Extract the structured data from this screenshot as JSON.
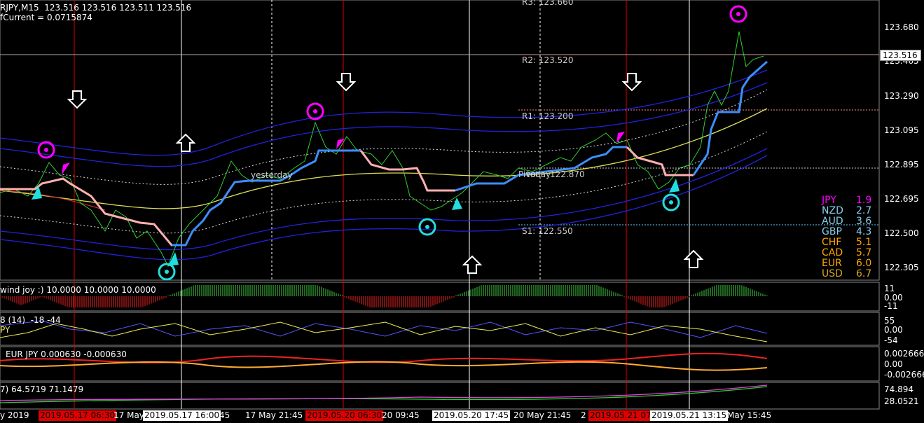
{
  "header": {
    "symbol_line": "RJPY,M15  123.516 123.516 123.511 123.516",
    "current_line": "fCurrent = 0.0715874"
  },
  "pivots": {
    "r3": "R3: 123.660",
    "r2": "R2: 123.520",
    "r1": "R1: 123.200",
    "pivot": "Pivot",
    "today": "today",
    "pivot_val": "122.870",
    "s1": "S1: 122.550",
    "yesterday": "yesterday"
  },
  "price_axis": [
    "123.680",
    "123.465",
    "123.290",
    "123.095",
    "122.895",
    "122.695",
    "122.500",
    "122.305"
  ],
  "current_price": "123.516",
  "currency_strength": [
    {
      "sym": "JPY",
      "val": "1.9",
      "color": "#ff00ff"
    },
    {
      "sym": "NZD",
      "val": "2.7",
      "color": "#87ceeb"
    },
    {
      "sym": "AUD",
      "val": "3.6",
      "color": "#87ceeb"
    },
    {
      "sym": "GBP",
      "val": "4.3",
      "color": "#87ceeb"
    },
    {
      "sym": "CHF",
      "val": "5.1",
      "color": "#ffa500"
    },
    {
      "sym": "CAD",
      "val": "5.7",
      "color": "#ffa500"
    },
    {
      "sym": "EUR",
      "val": "6.0",
      "color": "#ffa500"
    },
    {
      "sym": "USD",
      "val": "6.7",
      "color": "#daa520"
    }
  ],
  "indicators": {
    "ind1": {
      "label": "wind joy :) 10.0000 10.0000 10.0000",
      "axis": [
        "11",
        "0.00",
        "-11"
      ]
    },
    "ind2": {
      "label": "8 (14)  -18 -44",
      "sub": "PY",
      "axis": [
        "55",
        "0.00",
        "-54"
      ]
    },
    "ind3": {
      "label": "EUR JPY 0.000630 -0.000630",
      "axis": [
        "0.002666",
        "0.00",
        "-0.002666"
      ]
    },
    "ind4": {
      "label": "7) 64.5719 71.1479",
      "axis": [
        "74.894",
        "28.0521"
      ]
    }
  },
  "time_axis": [
    {
      "text": "y 2019",
      "style": "plain"
    },
    {
      "text": "2019.05.17 06:30",
      "style": "red"
    },
    {
      "text": "17 May 1",
      "style": "plain"
    },
    {
      "text": "2019.05.17 16:00",
      "style": "white"
    },
    {
      "text": "45",
      "style": "plain"
    },
    {
      "text": "17 May 21:45",
      "style": "plain"
    },
    {
      "text": "2019.05.20 06:30",
      "style": "red"
    },
    {
      "text": "20 09:45",
      "style": "plain"
    },
    {
      "text": "2019.05.20 17:45",
      "style": "white"
    },
    {
      "text": "20 May 21:45",
      "style": "plain"
    },
    {
      "text": "2",
      "style": "plain"
    },
    {
      "text": "2019.05.21 07",
      "style": "red"
    },
    {
      "text": "2019.05.21 13:15",
      "style": "white"
    },
    {
      "text": "May 15:45",
      "style": "plain"
    }
  ]
}
